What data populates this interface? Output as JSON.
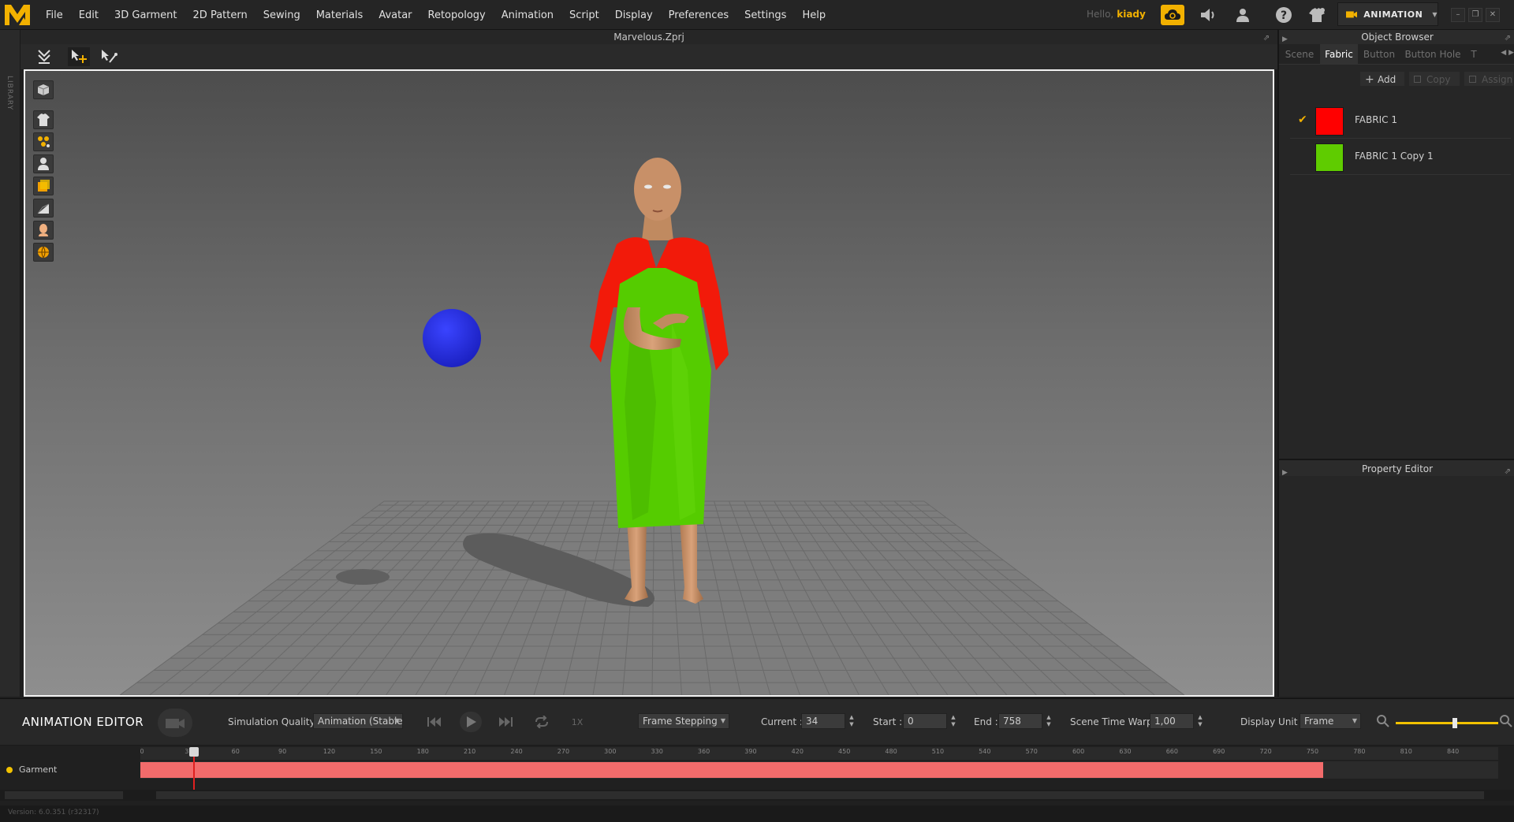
{
  "menubar": {
    "items": [
      "File",
      "Edit",
      "3D Garment",
      "2D Pattern",
      "Sewing",
      "Materials",
      "Avatar",
      "Retopology",
      "Animation",
      "Script",
      "Display",
      "Preferences",
      "Settings",
      "Help"
    ],
    "hello": "Hello,",
    "username": "kiady",
    "mode": "ANIMATION"
  },
  "library": {
    "label": "LIBRARY"
  },
  "viewport": {
    "title": "Marvelous.Zprj"
  },
  "object_browser": {
    "title": "Object Browser",
    "tabs": [
      "Scene",
      "Fabric",
      "Button",
      "Button Hole",
      "T"
    ],
    "active_tab": "Fabric",
    "toolbar": {
      "add": "Add",
      "copy": "Copy",
      "assign": "Assign"
    },
    "fabrics": [
      {
        "name": "FABRIC 1",
        "color": "#ff0000",
        "checked": true
      },
      {
        "name": "FABRIC 1 Copy 1",
        "color": "#5fcc00",
        "checked": false
      }
    ]
  },
  "property_editor": {
    "title": "Property Editor"
  },
  "animation_editor": {
    "title": "ANIMATION EDITOR",
    "simulation_quality_label": "Simulation Quality",
    "simulation_quality_value": "Animation (Stable",
    "speed_label": "1X",
    "frame_stepping": "Frame Stepping",
    "current_label": "Current :",
    "current_value": "34",
    "start_label": "Start :",
    "start_value": "0",
    "end_label": "End :",
    "end_value": "758",
    "time_warp_label": "Scene Time Warp",
    "time_warp_value": "1,00",
    "display_unit_label": "Display Unit",
    "display_unit_value": "Frame",
    "zoom_level": 0.58,
    "timeline": {
      "ticks": [
        "0",
        "30",
        "60",
        "90",
        "120",
        "150",
        "180",
        "210",
        "240",
        "270",
        "300",
        "330",
        "360",
        "390",
        "420",
        "450",
        "480",
        "510",
        "540",
        "570",
        "600",
        "630",
        "660",
        "690",
        "720",
        "750",
        "780",
        "810",
        "840"
      ],
      "max_frame": 870,
      "track": {
        "name": "Garment",
        "start": 0,
        "end": 758
      },
      "playhead_frame": 34
    }
  },
  "status": {
    "version": "Version: 6.0.351 (r32317)"
  },
  "colors": {
    "accent": "#f2c200",
    "track": "#f26b6b",
    "playhead": "#e02020"
  }
}
